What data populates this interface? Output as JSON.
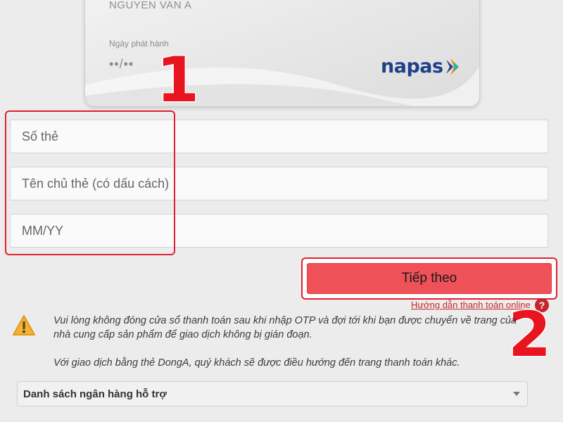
{
  "card": {
    "holder_name": "NGUYEN VAN A",
    "issue_date_label": "Ngày phát hành",
    "issue_date_value": "••/••",
    "brand": "napas"
  },
  "form": {
    "card_number_placeholder": "Số thẻ",
    "holder_name_placeholder": "Tên chủ thẻ (có dấu cách)",
    "issue_date_placeholder": "MM/YY"
  },
  "actions": {
    "next_label": "Tiếp theo",
    "help_link": "Hướng dẫn thanh toán online",
    "help_icon": "?"
  },
  "notice": {
    "line1": "Vui lòng không đóng cửa sổ thanh toán sau khi nhập OTP và đợi tới khi bạn được chuyển về trang của nhà cung cấp sản phẩm để giao dịch không bị gián đoạn.",
    "line2": "Với giao dịch bằng thẻ DongA, quý khách sẽ được điều hướng đến trang thanh toán khác."
  },
  "bank_list": {
    "label": "Danh sách ngân hàng hỗ trợ"
  },
  "markers": {
    "step1": "1",
    "step2": "2"
  },
  "colors": {
    "accent_red": "#e0202f",
    "button_red": "#ee5157",
    "napas_blue": "#1f3f88",
    "napas_orange": "#f28c1b"
  }
}
